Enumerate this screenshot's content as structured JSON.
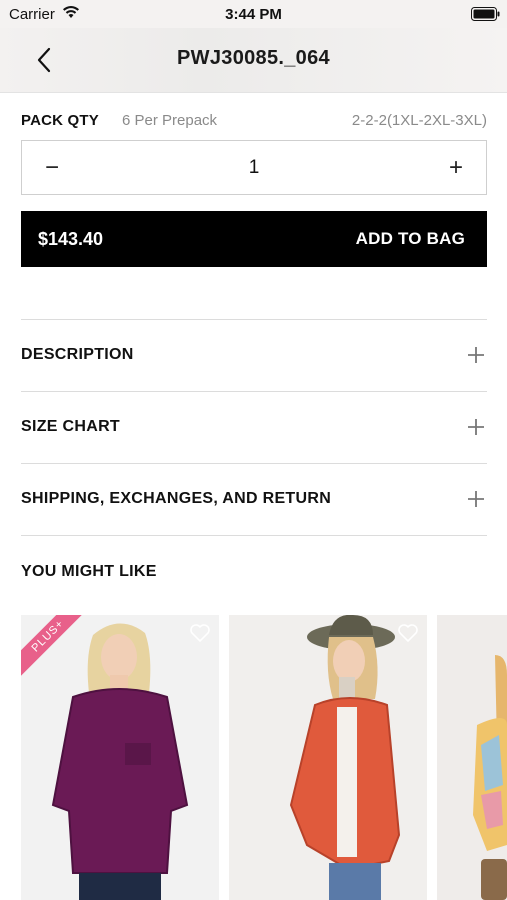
{
  "status_bar": {
    "carrier": "Carrier",
    "time": "3:44 PM"
  },
  "header": {
    "title": "PWJ30085._064"
  },
  "pack": {
    "label": "PACK QTY",
    "subtitle": "6 Per Prepack",
    "size_ratio": "2-2-2(1XL-2XL-3XL)"
  },
  "quantity": {
    "minus": "−",
    "value": "1",
    "plus": "+"
  },
  "add_to_bag": {
    "price": "$143.40",
    "label": "ADD TO BAG"
  },
  "accordion": [
    {
      "label": "DESCRIPTION"
    },
    {
      "label": "SIZE CHART"
    },
    {
      "label": "SHIPPING, EXCHANGES, AND RETURN"
    }
  ],
  "recommendations": {
    "title": "YOU MIGHT LIKE",
    "items": [
      {
        "badge": "PLUS+",
        "garment_color": "#6a1a55"
      },
      {
        "garment_color": "#e05a3c"
      },
      {
        "garment_color": "#e8b86a"
      }
    ]
  }
}
